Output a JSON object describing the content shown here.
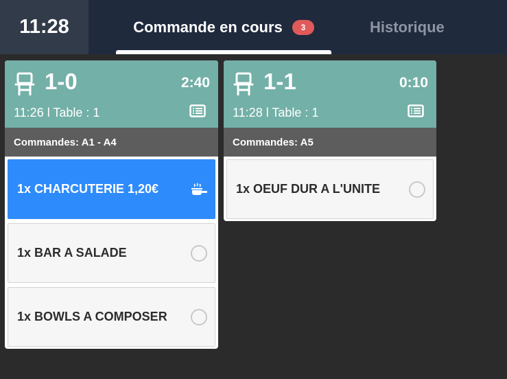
{
  "header": {
    "clock": "11:28",
    "tabs": [
      {
        "label": "Commande en cours",
        "badge": "3",
        "active": true
      },
      {
        "label": "Historique",
        "active": false
      }
    ]
  },
  "tickets": [
    {
      "table_label": "1-0",
      "timer": "2:40",
      "meta": "11:26 l Table : 1",
      "orders": "Commandes: A1 - A4",
      "items": [
        {
          "label": "1x CHARCUTERIE 1,20€",
          "status": "in-progress"
        },
        {
          "label": "1x BAR A SALADE",
          "status": "pending"
        },
        {
          "label": "1x BOWLS A COMPOSER",
          "status": "pending"
        }
      ]
    },
    {
      "table_label": "1-1",
      "timer": "0:10",
      "meta": "11:28 l Table : 1",
      "orders": "Commandes: A5",
      "items": [
        {
          "label": "1x OEUF DUR A L'UNITE",
          "status": "pending"
        }
      ]
    }
  ],
  "colors": {
    "header_bg": "#1f2a3d",
    "clock_bg": "#323b4a",
    "card_header": "#73b0a7",
    "orders_bar": "#5d5d5d",
    "active_item": "#2e8bfb",
    "badge": "#e05a5a",
    "background": "#2b2b2b"
  },
  "icons": {
    "table": "chair-icon",
    "note": "note-icon",
    "in_progress": "cooking-pot-icon",
    "pending": "radio-circle-icon"
  }
}
